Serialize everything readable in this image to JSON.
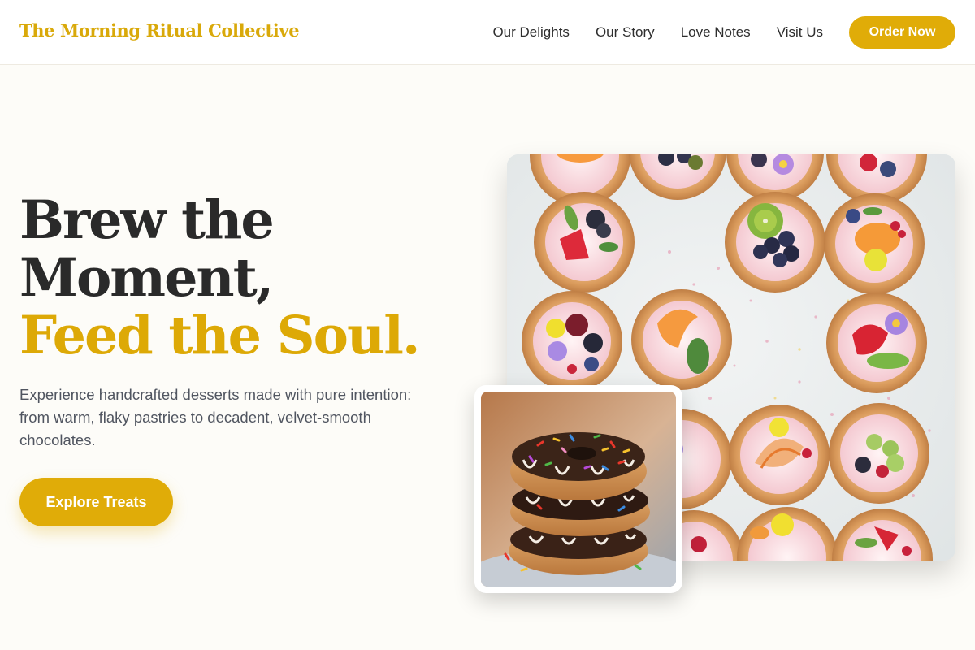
{
  "header": {
    "logo": "The Morning Ritual Collective",
    "nav": [
      {
        "label": "Our Delights"
      },
      {
        "label": "Our Story"
      },
      {
        "label": "Love Notes"
      },
      {
        "label": "Visit Us"
      }
    ],
    "cta_label": "Order Now"
  },
  "hero": {
    "title_line1": "Brew the",
    "title_line2": "Moment,",
    "title_line3": "Feed the Soul.",
    "subtitle": "Experience handcrafted desserts made with pure intention: from warm, flaky pastries to decadent, velvet-smooth chocolates.",
    "cta_label": "Explore Treats"
  },
  "colors": {
    "accent": "#e0ac08",
    "heading": "#2a2a2a",
    "background": "#fdfcf8"
  },
  "images": {
    "main": "fruit-tartlets-photo",
    "inset": "stacked-donuts-photo"
  }
}
